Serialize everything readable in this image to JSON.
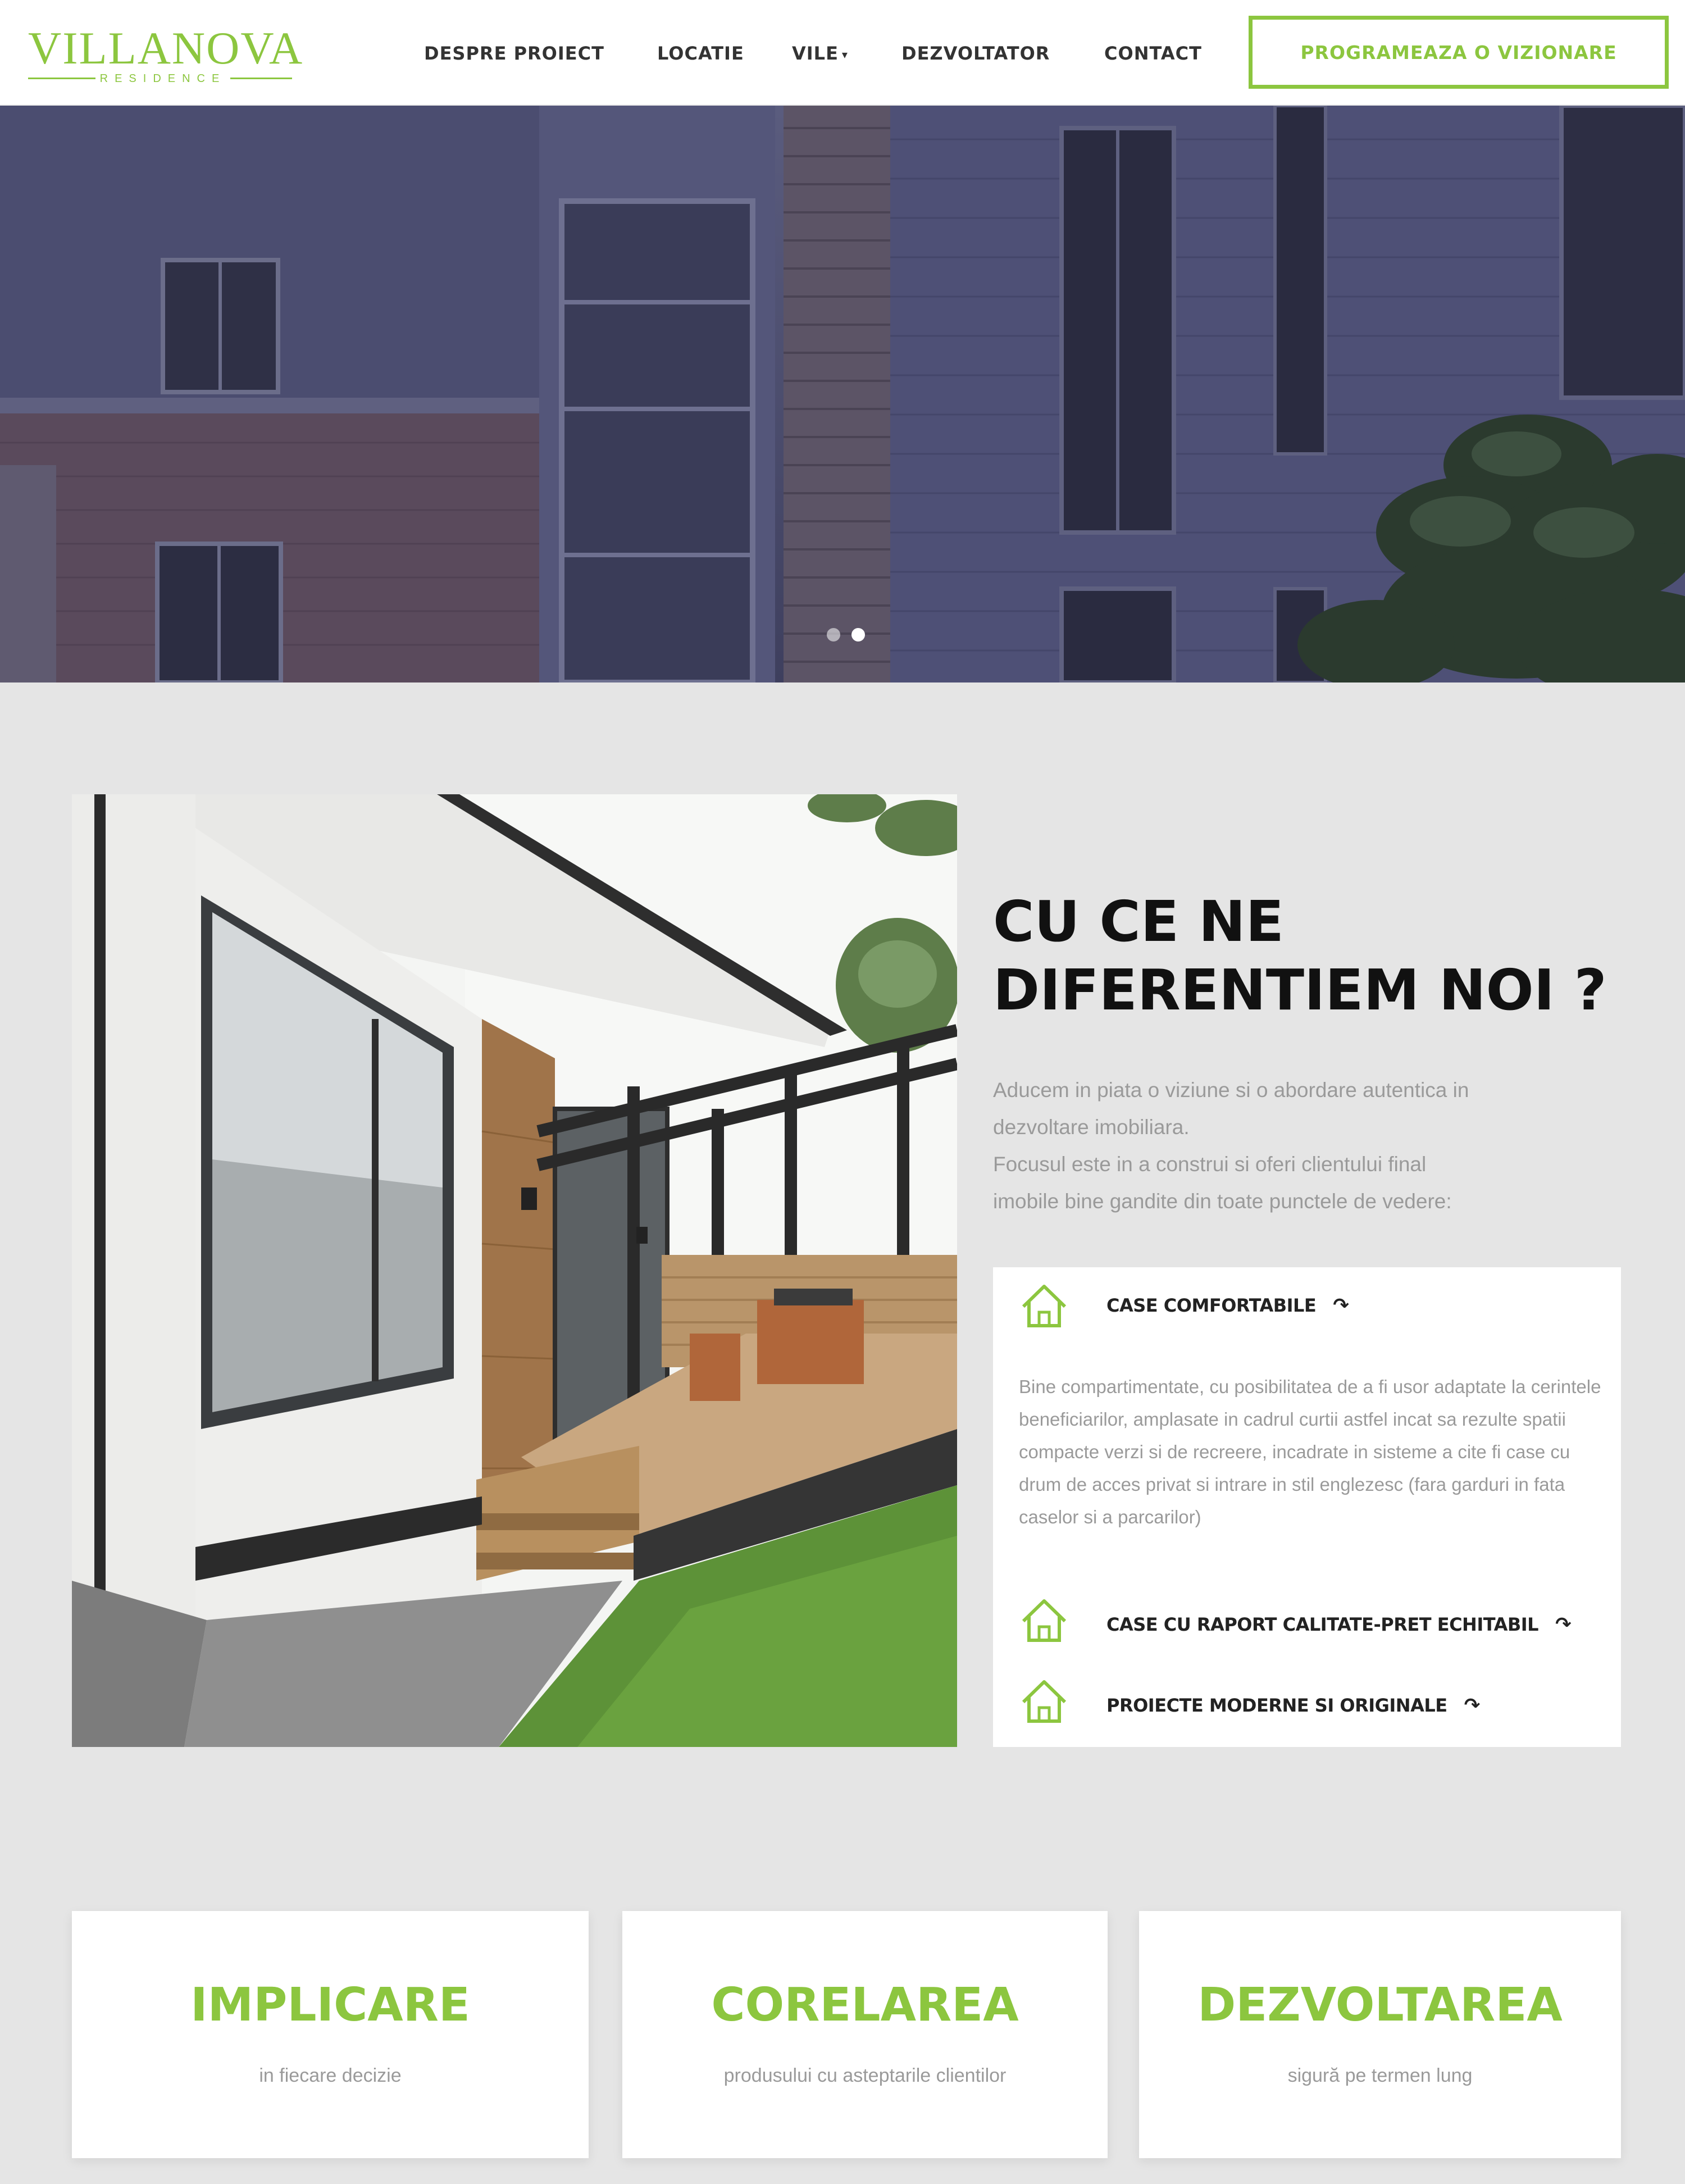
{
  "brand": {
    "logo_text": "VILLANOVA",
    "logo_subtext": "RESIDENCE",
    "accent_color": "#8cc63f"
  },
  "nav": {
    "items": [
      {
        "label": "DESPRE PROIECT"
      },
      {
        "label": "LOCATIE"
      },
      {
        "label": "VILE",
        "has_dropdown": true
      },
      {
        "label": "DEZVOLTATOR"
      },
      {
        "label": "CONTACT"
      }
    ],
    "cta_label": "PROGRAMEAZA O VIZIONARE"
  },
  "hero": {
    "slide_count": 2,
    "active_slide": 2
  },
  "features": {
    "title_line1": "CU CE NE",
    "title_line2": "DIFERENTIEM NOI ?",
    "intro_p1": "Aducem in piata o viziune si o abordare autentica in\ndezvoltare imobiliara.",
    "intro_p2": "Focusul este in a construi si oferi clientului final\nimobile bine gandite din toate punctele de vedere:",
    "items": [
      {
        "icon": "house-outline-icon",
        "title": "CASE COMFORTABILE",
        "expanded": true,
        "body": "Bine compartimentate, cu posibilitatea de a fi usor adaptate la cerintele beneficiarilor, amplasate in cadrul curtii astfel incat sa rezulte spatii compacte verzi si de recreere, incadrate in sisteme a cite fi case cu drum de acces privat si intrare in stil englezesc (fara garduri in fata caselor si a parcarilor)"
      },
      {
        "icon": "house-outline-icon",
        "title": "CASE CU RAPORT CALITATE-PRET ECHITABIL",
        "expanded": false
      },
      {
        "icon": "house-outline-icon",
        "title": "PROIECTE MODERNE SI ORIGINALE",
        "expanded": false
      }
    ],
    "arrow_glyph": "↷"
  },
  "values": [
    {
      "title": "IMPLICARE",
      "subtitle": "in fiecare decizie"
    },
    {
      "title": "CORELAREA",
      "subtitle": "produsului cu asteptarile clientilor"
    },
    {
      "title": "DEZVOLTAREA",
      "subtitle": "sigură pe termen lung"
    }
  ]
}
